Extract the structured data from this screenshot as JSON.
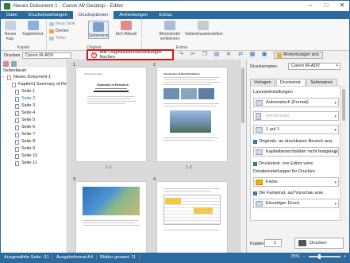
{
  "window": {
    "title": "Neues Dokument 1 - Canon iW Desktop - Editor"
  },
  "ribbon_tabs": [
    "Datei",
    "Druckeinstellungen",
    "Druckoptionen",
    "Anmerkungen",
    "Extras"
  ],
  "ribbon": {
    "groups": [
      "Kapitel",
      "Original",
      "Extras"
    ],
    "buttons": {
      "neues_kap": "Neues Kap.",
      "kapitelinst": "Kapiteleinst.",
      "neue_seite": "Neue Seite",
      "drehen": "Drehen",
      "teilen": "Teilen",
      "seiteninst": "Seiteneinst.",
      "einf_aktuell": "Einf./Aktuell",
      "blockraender": "Blockränder verkleinern",
      "seitendruck": "Seitendruckeinstellun"
    }
  },
  "toolbar": {
    "drucken_label": "Drucken",
    "printer_value": "Canon iR-ADV",
    "reset_button": "Alle Originalseiteneinstellungen löschen",
    "annotations_button": "Anmerkungen anz."
  },
  "left_panel": {
    "title": "Seitenbaum",
    "root": "Neues Dokument 1",
    "chapter": "Kapitel1| Summary of Re",
    "pages": [
      "Seite 1",
      "Seite 2",
      "Seite 3",
      "Seite 4",
      "Seite 5",
      "Seite 6",
      "Seite 7",
      "Seite 8",
      "Seite 9",
      "Seite 10",
      "Seite 11"
    ]
  },
  "canvas": {
    "page_labels": [
      "1-1",
      "1-2"
    ],
    "page_indices": [
      "1",
      "2",
      "3",
      "4"
    ],
    "page1_heading": "Summary of Research",
    "page1_author": "Tom Sonnenstein",
    "page2_heading": "Introduction of Bird Distribution"
  },
  "right_panel": {
    "printer_label": "Druckername:",
    "printer_value": "Canon iR-ADV",
    "tabs": [
      "Vorlagen",
      "Druckeinst.",
      "Seiteneinst."
    ],
    "layout_label": "Layouteinstellungen",
    "layout_value": "Automatisch (Format)",
    "hochformat": "Hochformat",
    "one_on_one": "1 auf 1",
    "chk_originals": "Originals. an druckbaren Bereich anp.",
    "kapitelbereiche": "Kapitelbereichblätter nicht festgelegt",
    "chk_editor": "Druckeinst. von Editor verw.",
    "color_label": "Detaileinstellungen für Drucken",
    "color_value": "Farbe",
    "chk_preview": "Die Farbeinst. auf Vorschau anw.",
    "print_mode": "Einseitiger Druck",
    "copies_label": "Kopien",
    "copies_value": "1",
    "print_button": "Drucken"
  },
  "statusbar": {
    "selected": "Ausgewählte Seite: /11",
    "format": "Ausgabeformat:A4",
    "sheets": "Blätter gesamt: 11",
    "zoom": "25%"
  }
}
